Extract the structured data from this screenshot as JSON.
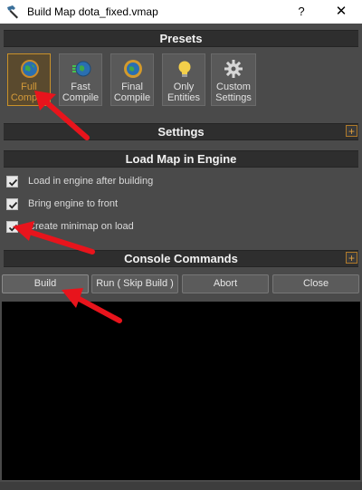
{
  "window": {
    "title": "Build Map dota_fixed.vmap",
    "help_button": "?",
    "close_button": "✕"
  },
  "sections": {
    "presets": "Presets",
    "settings": "Settings",
    "load_map": "Load Map in Engine",
    "console": "Console Commands",
    "expand_symbol": "+"
  },
  "presets": [
    {
      "label": "Full\nCompile",
      "icon": "globe-icon",
      "active": true
    },
    {
      "label": "Fast\nCompile",
      "icon": "fast-globe-icon",
      "active": false
    },
    {
      "label": "Final\nCompile",
      "icon": "gold-globe-icon",
      "active": false
    },
    {
      "label": "Only\nEntities",
      "icon": "lightbulb-icon",
      "active": false
    },
    {
      "label": "Custom\nSettings",
      "icon": "gear-icon",
      "active": false
    }
  ],
  "load_options": [
    {
      "label": "Load in engine after building",
      "checked": true
    },
    {
      "label": "Bring engine to front",
      "checked": true
    },
    {
      "label": "Create minimap on load",
      "checked": true
    }
  ],
  "console_buttons": {
    "build": "Build",
    "run": "Run ( Skip Build )",
    "abort": "Abort",
    "close": "Close"
  },
  "colors": {
    "background": "#4a4a4a",
    "section_header": "#2e2e2e",
    "accent_orange": "#c8912a",
    "annotation_arrow": "#e8141c",
    "console": "#000000"
  }
}
